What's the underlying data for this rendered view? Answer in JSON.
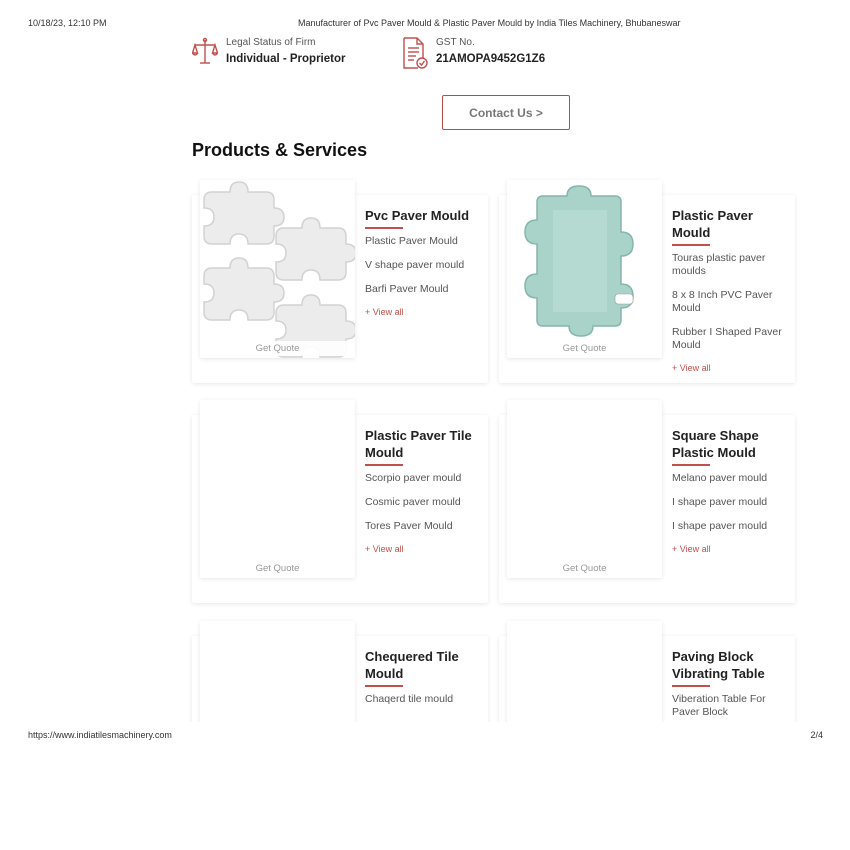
{
  "print_header": {
    "date": "10/18/23, 12:10 PM",
    "title": "Manufacturer of Pvc Paver Mould & Plastic Paver Mould by India Tiles Machinery, Bhubaneswar"
  },
  "print_footer": {
    "url": "https://www.indiatilesmachinery.com",
    "page": "2/4"
  },
  "firm_info": {
    "legal_status": {
      "label": "Legal Status of Firm",
      "value": "Individual - Proprietor",
      "icon": "scales-icon"
    },
    "gst": {
      "label": "GST No.",
      "value": "21AMOPA9452G1Z6",
      "icon": "gst-document-icon"
    }
  },
  "contact_button": {
    "label": "Contact Us >"
  },
  "products_section": {
    "title": "Products & Services",
    "get_quote_label": "Get Quote",
    "view_all_label": "+ View all",
    "cards": [
      {
        "title": "Pvc Paver Mould",
        "items": [
          "Plastic Paver Mould",
          "V shape paver mould",
          "Barfi Paver Mould"
        ]
      },
      {
        "title": "Plastic Paver Mould",
        "items": [
          "Touras plastic paver moulds",
          "8 x 8 Inch PVC Paver Mould",
          "Rubber I Shaped Paver Mould"
        ]
      },
      {
        "title": "Plastic Paver Tile Mould",
        "items": [
          "Scorpio paver mould",
          "Cosmic paver mould",
          "Tores Paver Mould"
        ]
      },
      {
        "title": "Square Shape Plastic Mould",
        "items": [
          "Melano paver mould",
          "I shape paver mould",
          "I shape paver mould"
        ]
      },
      {
        "title": "Chequered Tile Mould",
        "items": [
          "Chaqerd tile mould"
        ]
      },
      {
        "title": "Paving Block Vibrating Table",
        "items": [
          "Viberation Table For Paver Block"
        ]
      }
    ]
  },
  "colors": {
    "accent": "#c0504d",
    "button_border": "#b84a4a",
    "mould_green": "#a9d2c9",
    "mould_white": "#ececec"
  }
}
